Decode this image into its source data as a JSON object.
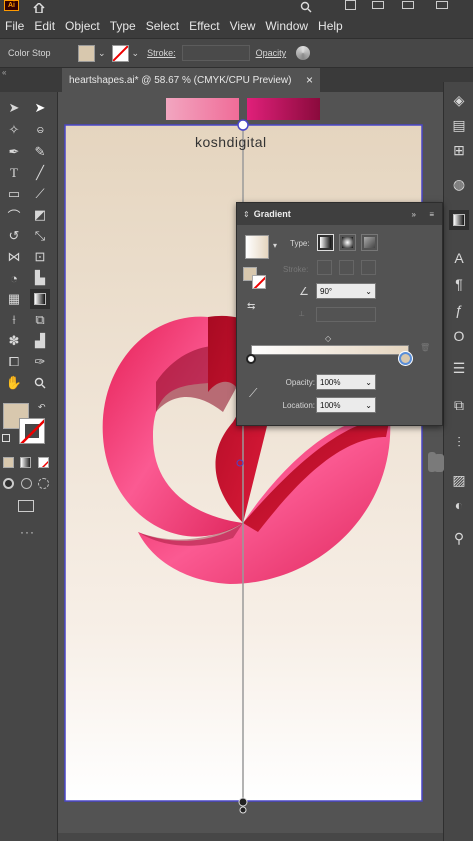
{
  "app": {
    "logo": "Ai"
  },
  "menu": [
    "File",
    "Edit",
    "Object",
    "Type",
    "Select",
    "Effect",
    "View",
    "Window",
    "Help"
  ],
  "control_bar": {
    "mode_label": "Color Stop",
    "stroke_label": "Stroke:",
    "opacity_label": "Opacity"
  },
  "document": {
    "tab_title": "heartshapes.ai* @ 58.67 % (CMYK/CPU Preview)",
    "close_glyph": "×"
  },
  "artwork": {
    "brand_text": "koshdigital"
  },
  "gradient_panel": {
    "title": "Gradient",
    "type_label": "Type:",
    "stroke_label": "Stroke:",
    "angle_value": "90°",
    "opacity_label": "Opacity:",
    "opacity_value": "100%",
    "location_label": "Location:",
    "location_value": "100%"
  },
  "colors": {
    "ui_dark": "#3c3c3c",
    "ui_panel": "#535353",
    "artboard_top": "#e5d5bf",
    "artboard_bottom": "#ffffff",
    "heart_pink": "#f0407c",
    "heart_red": "#c4102e",
    "selection_blue": "#4a46c8",
    "swatch_beige": "#d8c8ae"
  },
  "icons": [
    "home-icon",
    "search-icon",
    "arrange-icon",
    "selection-tool-icon",
    "direct-selection-icon",
    "pen-icon",
    "type-icon",
    "gradient-tool-icon",
    "eyedropper-icon",
    "hand-icon",
    "zoom-icon",
    "layers-icon",
    "properties-icon"
  ]
}
